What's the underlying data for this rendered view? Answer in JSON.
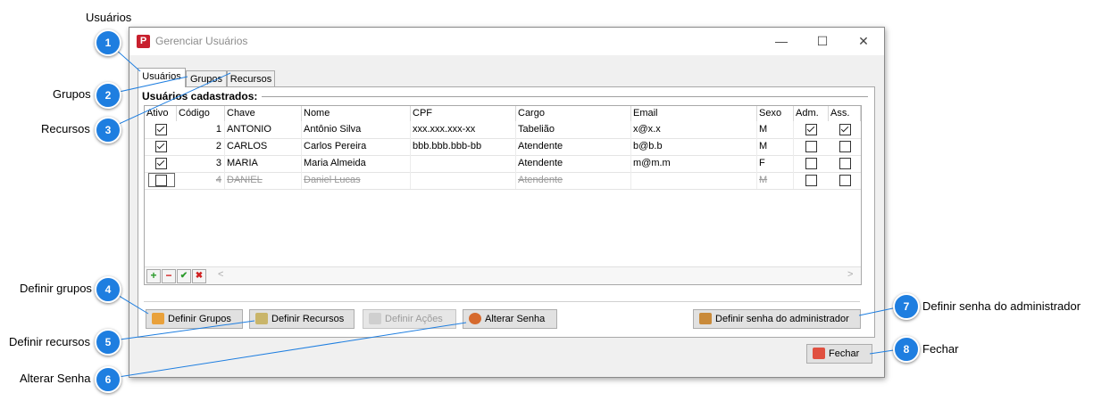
{
  "caption": "Usuários",
  "window": {
    "title": "Gerenciar Usuários",
    "app_icon_letter": "P",
    "minimize": "—",
    "maximize": "☐",
    "close": "✕"
  },
  "tabs": [
    "Usuários",
    "Grupos",
    "Recursos"
  ],
  "group_title": "Usuários cadastrados:",
  "columns": [
    "Ativo",
    "Código",
    "Chave",
    "Nome",
    "CPF",
    "Cargo",
    "Email",
    "Sexo",
    "Adm.",
    "Ass."
  ],
  "rows": [
    {
      "ativo": true,
      "codigo": "1",
      "chave": "ANTONIO",
      "nome": "Antônio Silva",
      "cpf": "xxx.xxx.xxx-xx",
      "cargo": "Tabelião",
      "email": "x@x.x",
      "sexo": "M",
      "adm": true,
      "ass": true,
      "deleted": false
    },
    {
      "ativo": true,
      "codigo": "2",
      "chave": "CARLOS",
      "nome": "Carlos Pereira",
      "cpf": "bbb.bbb.bbb-bb",
      "cargo": "Atendente",
      "email": "b@b.b",
      "sexo": "M",
      "adm": false,
      "ass": false,
      "deleted": false
    },
    {
      "ativo": true,
      "codigo": "3",
      "chave": "MARIA",
      "nome": "Maria Almeida",
      "cpf": "",
      "cargo": "Atendente",
      "email": "m@m.m",
      "sexo": "F",
      "adm": false,
      "ass": false,
      "deleted": false
    },
    {
      "ativo": false,
      "codigo": "4",
      "chave": "DANIEL",
      "nome": "Daniel Lucas",
      "cpf": "",
      "cargo": "Atendente",
      "email": "",
      "sexo": "M",
      "adm": false,
      "ass": false,
      "deleted": true
    }
  ],
  "navigator": {
    "add": "+",
    "remove": "−",
    "confirm": "✔",
    "cancel": "✖",
    "scroll_left": "<",
    "scroll_right": ">"
  },
  "buttons": {
    "definir_grupos": "Definir Grupos",
    "definir_recursos": "Definir Recursos",
    "definir_acoes": "Definir Ações",
    "alterar_senha": "Alterar Senha",
    "definir_senha_admin": "Definir senha do administrador",
    "fechar": "Fechar"
  },
  "callouts": [
    {
      "n": "1",
      "label": ""
    },
    {
      "n": "2",
      "label": "Grupos"
    },
    {
      "n": "3",
      "label": "Recursos"
    },
    {
      "n": "4",
      "label": "Definir grupos"
    },
    {
      "n": "5",
      "label": "Definir recursos"
    },
    {
      "n": "6",
      "label": "Alterar Senha"
    },
    {
      "n": "7",
      "label": "Definir senha do administrador"
    },
    {
      "n": "8",
      "label": "Fechar"
    }
  ],
  "colors": {
    "callout": "#1e7ee0",
    "callout_line": "#1e7ee0",
    "title_icon": "#c8202e"
  }
}
